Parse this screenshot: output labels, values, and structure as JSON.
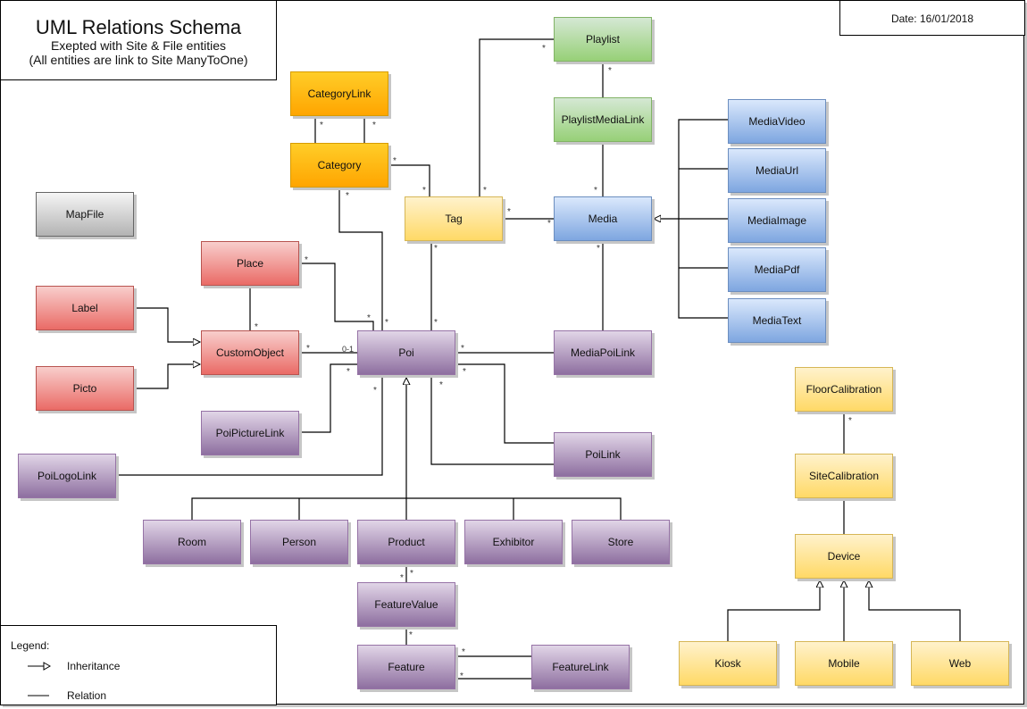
{
  "header": {
    "title": "UML Relations Schema",
    "subtitle_1": "Exepted with Site & File entities",
    "subtitle_2": "(All entities are link to Site ManyToOne)",
    "date": "Date: 16/01/2018"
  },
  "legend": {
    "title": "Legend:",
    "inheritance": "Inheritance",
    "relation": "Relation"
  },
  "colors": {
    "orange": "#ffa500",
    "green": "#97d077",
    "blue": "#7ea6e0",
    "yellow": "#ffd966",
    "red": "#ea6b66",
    "purple": "#8e6fa0",
    "gray": "#b3b3b3"
  },
  "entities": {
    "playlist": "Playlist",
    "playlist_media_link": "PlaylistMediaLink",
    "category_link": "CategoryLink",
    "category": "Category",
    "tag": "Tag",
    "media": "Media",
    "media_video": "MediaVideo",
    "media_url": "MediaUrl",
    "media_image": "MediaImage",
    "media_pdf": "MediaPdf",
    "media_text": "MediaText",
    "map_file": "MapFile",
    "place": "Place",
    "label": "Label",
    "custom_object": "CustomObject",
    "picto": "Picto",
    "poi": "Poi",
    "media_poi_link": "MediaPoiLink",
    "poi_picture_link": "PoiPictureLink",
    "poi_link": "PoiLink",
    "poi_logo_link": "PoiLogoLink",
    "room": "Room",
    "person": "Person",
    "product": "Product",
    "exhibitor": "Exhibitor",
    "store": "Store",
    "feature_value": "FeatureValue",
    "feature": "Feature",
    "feature_link": "FeatureLink",
    "floor_calibration": "FloorCalibration",
    "site_calibration": "SiteCalibration",
    "device": "Device",
    "kiosk": "Kiosk",
    "mobile": "Mobile",
    "web": "Web"
  },
  "multiplicities": {
    "many": "*",
    "zero_or_one": "0-1"
  },
  "relations": [
    {
      "from": "Tag",
      "to": "Playlist",
      "type": "relation",
      "from_mult": "*",
      "to_mult": "*"
    },
    {
      "from": "Playlist",
      "to": "PlaylistMediaLink",
      "type": "relation",
      "from_mult": "*",
      "to_mult": ""
    },
    {
      "from": "PlaylistMediaLink",
      "to": "Media",
      "type": "relation",
      "from_mult": "",
      "to_mult": "*"
    },
    {
      "from": "CategoryLink",
      "to": "Category",
      "type": "relation",
      "from_mult": "*",
      "to_mult": ""
    },
    {
      "from": "CategoryLink",
      "to": "Category",
      "type": "relation",
      "from_mult": "*",
      "to_mult": ""
    },
    {
      "from": "Category",
      "to": "Tag",
      "type": "relation",
      "from_mult": "*",
      "to_mult": "*"
    },
    {
      "from": "Category",
      "to": "Poi",
      "type": "relation",
      "from_mult": "*",
      "to_mult": "*"
    },
    {
      "from": "Tag",
      "to": "Media",
      "type": "relation",
      "from_mult": "*",
      "to_mult": "*"
    },
    {
      "from": "Tag",
      "to": "Poi",
      "type": "relation",
      "from_mult": "*",
      "to_mult": "*"
    },
    {
      "from": "MediaVideo",
      "to": "Media",
      "type": "inheritance"
    },
    {
      "from": "MediaUrl",
      "to": "Media",
      "type": "inheritance"
    },
    {
      "from": "MediaImage",
      "to": "Media",
      "type": "inheritance"
    },
    {
      "from": "MediaPdf",
      "to": "Media",
      "type": "inheritance"
    },
    {
      "from": "MediaText",
      "to": "Media",
      "type": "inheritance"
    },
    {
      "from": "Media",
      "to": "MediaPoiLink",
      "type": "relation",
      "from_mult": "*",
      "to_mult": ""
    },
    {
      "from": "Poi",
      "to": "MediaPoiLink",
      "type": "relation",
      "from_mult": "*",
      "to_mult": ""
    },
    {
      "from": "Place",
      "to": "Poi",
      "type": "relation",
      "from_mult": "*",
      "to_mult": "*"
    },
    {
      "from": "Place",
      "to": "CustomObject",
      "type": "relation",
      "from_mult": "",
      "to_mult": "*"
    },
    {
      "from": "Label",
      "to": "CustomObject",
      "type": "inheritance"
    },
    {
      "from": "Picto",
      "to": "CustomObject",
      "type": "inheritance"
    },
    {
      "from": "CustomObject",
      "to": "Poi",
      "type": "relation",
      "from_mult": "*",
      "to_mult": "0-1"
    },
    {
      "from": "PoiPictureLink",
      "to": "Poi",
      "type": "relation",
      "from_mult": "",
      "to_mult": "*"
    },
    {
      "from": "PoiLogoLink",
      "to": "Poi",
      "type": "relation",
      "from_mult": "",
      "to_mult": "*"
    },
    {
      "from": "Poi",
      "to": "PoiLink",
      "type": "relation",
      "from_mult": "*",
      "to_mult": ""
    },
    {
      "from": "Poi",
      "to": "PoiLink",
      "type": "relation",
      "from_mult": "*",
      "to_mult": ""
    },
    {
      "from": "Room",
      "to": "Poi",
      "type": "inheritance"
    },
    {
      "from": "Person",
      "to": "Poi",
      "type": "inheritance"
    },
    {
      "from": "Product",
      "to": "Poi",
      "type": "inheritance"
    },
    {
      "from": "Exhibitor",
      "to": "Poi",
      "type": "inheritance"
    },
    {
      "from": "Store",
      "to": "Poi",
      "type": "inheritance"
    },
    {
      "from": "Product",
      "to": "FeatureValue",
      "type": "relation",
      "from_mult": "*",
      "to_mult": "*"
    },
    {
      "from": "FeatureValue",
      "to": "Feature",
      "type": "relation",
      "from_mult": "*",
      "to_mult": ""
    },
    {
      "from": "Feature",
      "to": "FeatureLink",
      "type": "relation",
      "from_mult": "*",
      "to_mult": ""
    },
    {
      "from": "Feature",
      "to": "FeatureLink",
      "type": "relation",
      "from_mult": "*",
      "to_mult": ""
    },
    {
      "from": "FloorCalibration",
      "to": "SiteCalibration",
      "type": "relation",
      "from_mult": "*",
      "to_mult": ""
    },
    {
      "from": "SiteCalibration",
      "to": "Device",
      "type": "relation",
      "from_mult": "",
      "to_mult": ""
    },
    {
      "from": "Kiosk",
      "to": "Device",
      "type": "inheritance"
    },
    {
      "from": "Mobile",
      "to": "Device",
      "type": "inheritance"
    },
    {
      "from": "Web",
      "to": "Device",
      "type": "inheritance"
    }
  ]
}
